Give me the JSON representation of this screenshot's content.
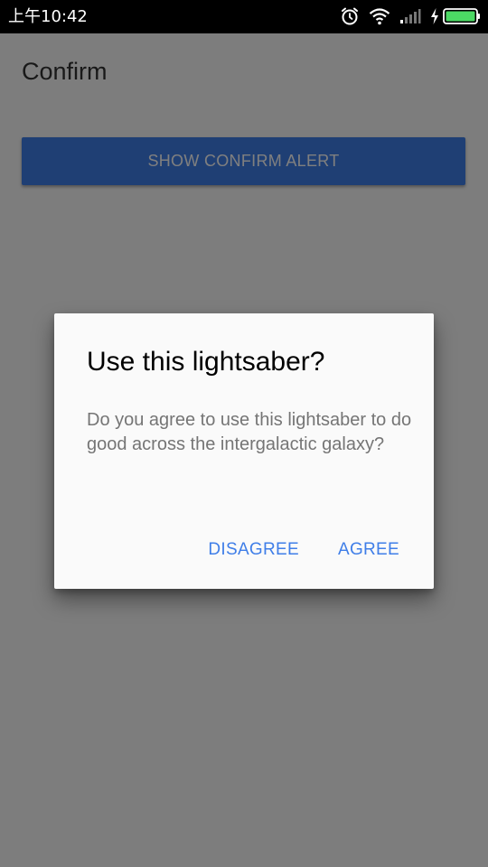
{
  "status_bar": {
    "time": "上午10:42",
    "icons": [
      "alarm-icon",
      "wifi-icon",
      "signal-icon",
      "charging-icon",
      "battery-icon"
    ]
  },
  "app": {
    "title": "Confirm",
    "show_confirm_button_label": "SHOW CONFIRM ALERT"
  },
  "dialog": {
    "title": "Use this lightsaber?",
    "message": "Do you agree to use this lightsaber to do good across the intergalactic galaxy?",
    "buttons": {
      "disagree": "DISAGREE",
      "agree": "AGREE"
    }
  },
  "colors": {
    "accent": "#3f7ee8",
    "status_bar": "#000000",
    "background": "#fafafa",
    "scrim": "rgba(0,0,0,0.5)",
    "battery_fill": "#4cd964"
  }
}
